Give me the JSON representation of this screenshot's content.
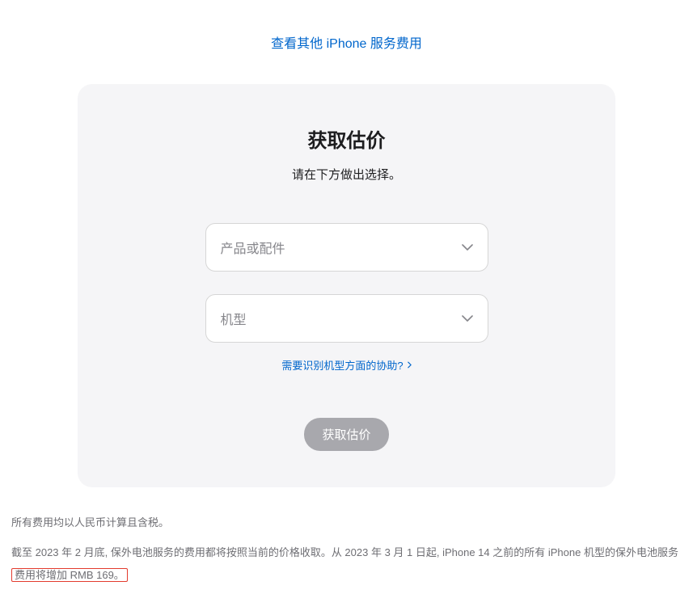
{
  "topLink": {
    "label": "查看其他 iPhone 服务费用"
  },
  "card": {
    "title": "获取估价",
    "subtitle": "请在下方做出选择。",
    "select1_placeholder": "产品或配件",
    "select2_placeholder": "机型",
    "helpLink": "需要识别机型方面的协助?",
    "button": "获取估价"
  },
  "footnotes": {
    "note1": "所有费用均以人民币计算且含税。",
    "note2_a": "截至 2023 年 2 月底, 保外电池服务的费用都将按照当前的价格收取。从 2023 年 3 月 1 日起, iPhone 14 之前的所有 iPhone 机型的保外电池服务",
    "note2_b": "费用将增加 RMB 169。"
  }
}
